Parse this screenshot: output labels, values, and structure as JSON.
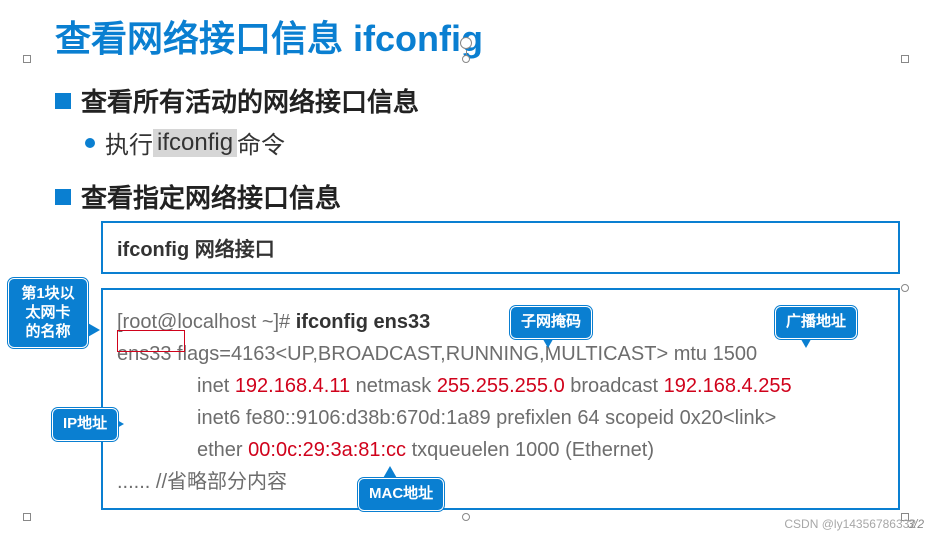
{
  "title": "查看网络接口信息 ifconfig",
  "section1": {
    "heading": "查看所有活动的网络接口信息",
    "sub_pre": "执行 ",
    "sub_cmd": "ifconfig",
    "sub_post": " 命令"
  },
  "section2": {
    "heading": "查看指定网络接口信息",
    "codebox": "ifconfig 网络接口"
  },
  "terminal": {
    "prompt": "[root@localhost ~]# ",
    "cmd": "ifconfig ens33",
    "l2_a": "ens33   flags=4163<UP,BROADCAST,RUNNING,MULTICAST>  mtu 1500",
    "l3_pre": "inet ",
    "l3_ip": "192.168.4.11",
    "l3_mid1": "  netmask ",
    "l3_mask": "255.255.255.0",
    "l3_mid2": "  broadcast ",
    "l3_bcast": "192.168.4.255",
    "l4": "inet6 fe80::9106:d38b:670d:1a89  prefixlen 64  scopeid 0x20<link>",
    "l5_pre": "ether ",
    "l5_mac": "00:0c:29:3a:81:cc",
    "l5_post": "  txqueuelen 1000  (Ethernet)",
    "l6": "...... //省略部分内容"
  },
  "callouts": {
    "nic_name": "第1块以太网卡的名称",
    "subnet": "子网掩码",
    "broadcast": "广播地址",
    "ip": "IP地址",
    "mac": "MAC地址"
  },
  "footer": "CSDN @ly14356786332",
  "page": "3/2"
}
